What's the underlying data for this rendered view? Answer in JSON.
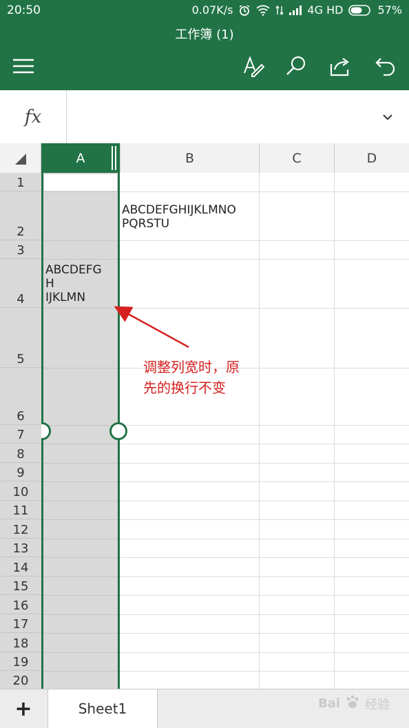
{
  "status_bar": {
    "time": "20:50",
    "network_speed": "0.07K/s",
    "network_type": "4G HD",
    "battery": "57%",
    "icons": [
      "alarm-icon",
      "wifi-icon",
      "data-transfer-icon",
      "signal-icon",
      "battery-icon"
    ]
  },
  "title_bar": {
    "title": "工作簿 (1)",
    "icons": [
      "menu-icon",
      "pen-format-icon",
      "search-icon",
      "share-icon",
      "undo-icon"
    ]
  },
  "formula_bar": {
    "fx_label": "fx",
    "value": ""
  },
  "grid": {
    "columns": [
      "A",
      "B",
      "C",
      "D"
    ],
    "selected_column": "A",
    "rows": [
      "1",
      "2",
      "3",
      "4",
      "5",
      "6",
      "7",
      "8",
      "9",
      "10",
      "11",
      "12",
      "13",
      "14",
      "15",
      "16",
      "17",
      "18",
      "19",
      "20"
    ],
    "cells": {
      "B2": "ABCDEFGHIJKLMNO\nPQRSTU",
      "A4": "ABCDEFG\nH\nIJKLMN"
    }
  },
  "annotation": {
    "text": "调整列宽时，原\n先的换行不变",
    "color": "#d62020"
  },
  "sheet_tabs": {
    "add_label": "+",
    "tabs": [
      "Sheet1"
    ],
    "active": "Sheet1"
  },
  "watermark": {
    "brand": "Bai",
    "suffix": "经验"
  },
  "colors": {
    "accent": "#217346",
    "column_selection": "#d9d9d9"
  }
}
